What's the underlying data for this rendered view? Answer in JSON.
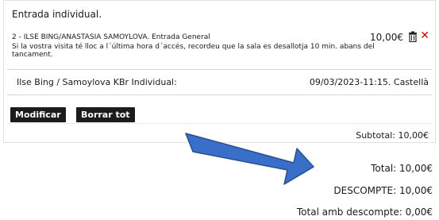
{
  "cart": {
    "heading": "Entrada individual.",
    "item": {
      "title": "2 - ILSE BING/ANASTASIA SAMOYLOVA. Entrada General",
      "price": "10,00€",
      "notice": "Si la vostra visita té lloc a l´última hora d´accés, recordeu que la sala es desallotja 10 min. abans del tancament."
    },
    "detail": {
      "name": "Ilse Bing / Samoylova KBr Individual:",
      "datetime": "09/03/2023-11:15. Castellà"
    },
    "buttons": {
      "modify": "Modificar",
      "clear": "Borrar tot"
    },
    "subtotal": "Subtotal: 10,00€"
  },
  "totals": {
    "total": "Total: 10,00€",
    "discount": "DESCOMPTE: 10,00€",
    "with_discount": "Total amb descompte: 0,00€"
  },
  "icons": {
    "trash": "trash-icon",
    "remove": "close-icon",
    "arrow": "arrow-icon"
  },
  "colors": {
    "button_bg": "#1c1c1c",
    "remove_red": "#d40000",
    "arrow_fill": "#3a6fc9",
    "arrow_stroke": "#2a4f8f"
  }
}
